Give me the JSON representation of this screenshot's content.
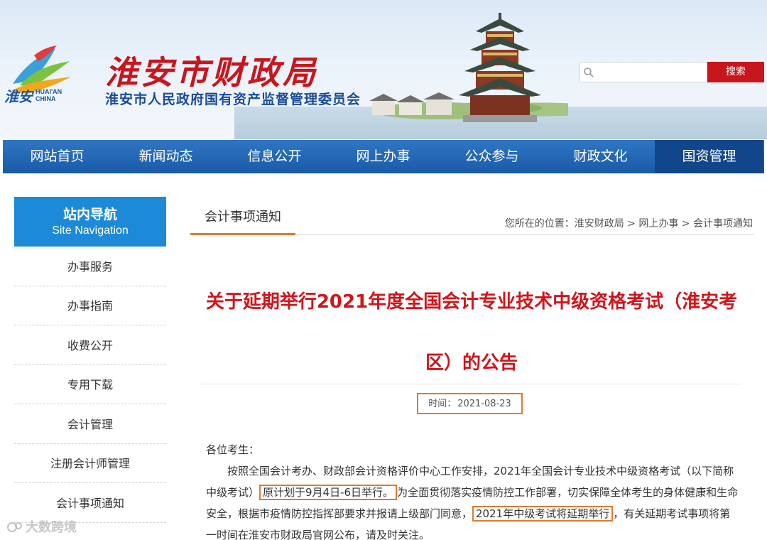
{
  "header": {
    "logo_text_cn": "淮安",
    "logo_text_en_line1": "HUAI'AN",
    "logo_text_en_line2": "CHINA",
    "site_title": "淮安市财政局",
    "site_subtitle": "淮安市人民政府国有资产监督管理委员会",
    "search_placeholder": "",
    "search_button": "搜索"
  },
  "nav": {
    "items": [
      {
        "label": "网站首页"
      },
      {
        "label": "新闻动态"
      },
      {
        "label": "信息公开"
      },
      {
        "label": "网上办事"
      },
      {
        "label": "公众参与"
      },
      {
        "label": "财政文化"
      },
      {
        "label": "国资管理"
      }
    ],
    "active_index": 6
  },
  "sidebar": {
    "title_cn": "站内导航",
    "title_en": "Site Navigation",
    "items": [
      {
        "label": "办事服务"
      },
      {
        "label": "办事指南"
      },
      {
        "label": "收费公开"
      },
      {
        "label": "专用下载"
      },
      {
        "label": "会计管理"
      },
      {
        "label": "注册会计师管理"
      },
      {
        "label": "会计事项通知"
      }
    ]
  },
  "main": {
    "tab_title": "会计事项通知",
    "breadcrumb": {
      "prefix": "您所在的位置：",
      "items": [
        "淮安财政局",
        "网上办事",
        "会计事项通知"
      ],
      "separator": " > "
    },
    "article": {
      "title": "关于延期举行2021年度全国会计专业技术中级资格考试（淮安考区）的公告",
      "date_label": "时间：",
      "date": "2021-08-23",
      "greeting": "各位考生：",
      "p1_a": "按照全国会计考办、财政部会计资格评价中心工作安排，2021年全国会计专业技术中级资格考试（以下简称中级考试）",
      "p1_hl1": "原计划于9月4日-6日举行。",
      "p1_b": "为全面贯彻落实疫情防控工作部署，切实保障全体考生的身体健康和生命安全，根据市疫情防控指挥部要求并报请上级部门同意，",
      "p1_hl2": "2021年中级考试将延期举行",
      "p1_c": "，有关延期考试事项将第一时间在淮安市财政局官网公布，请及时关注。"
    }
  },
  "watermark": "大数跨境",
  "colors": {
    "brand_red": "#c8161d",
    "nav_blue": "#1a5aa8",
    "sidebar_blue": "#1d8ad7",
    "highlight_orange": "#e07a2e",
    "title_red": "#d3141b"
  }
}
